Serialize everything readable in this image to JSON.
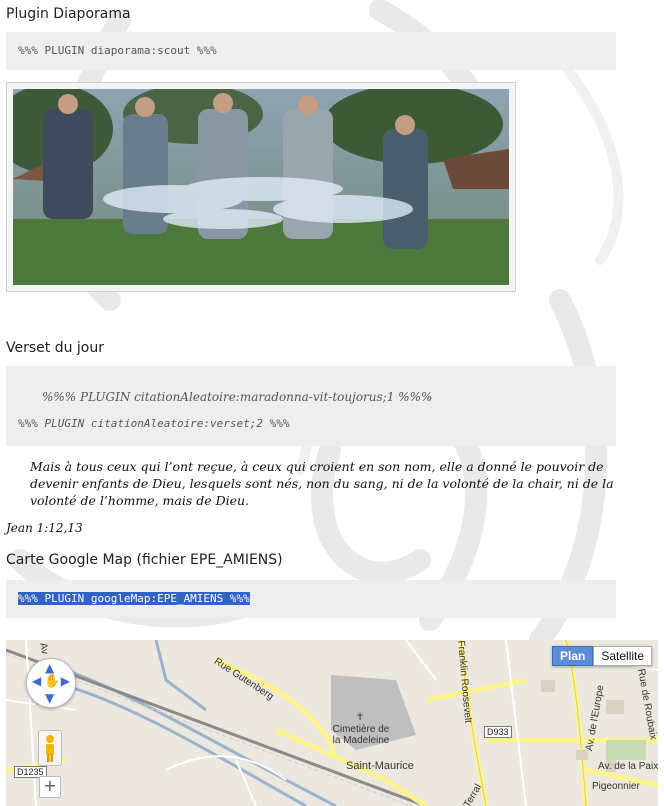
{
  "diaporama": {
    "heading": "Plugin Diaporama",
    "code": "%%% PLUGIN diaporama:scout %%%"
  },
  "verset": {
    "heading": "Verset du jour",
    "code_line_1": "%%% PLUGIN citationAleatoire:maradonna-vit-toujorus;1 %%%",
    "code_line_2": "%%% PLUGIN citationAleatoire:verset;2 %%%",
    "quote": "Mais à tous ceux qui l’ont reçue, à ceux qui croient en son nom, elle a donné le pouvoir de devenir enfants de Dieu, lesquels sont nés, non du sang, ni de la volonté de la chair, ni de la volonté de l’homme, mais de Dieu.",
    "reference": "Jean 1:12,13"
  },
  "carte": {
    "heading": "Carte Google Map (fichier EPE_AMIENS)",
    "code": "%%% PLUGIN googleMap:EPE_AMIENS %%%"
  },
  "map": {
    "plan_label": "Plan",
    "satellite_label": "Satellite",
    "labels": {
      "rue_gutenberg": "Rue Gutenberg",
      "cimetiere": "Cimetière de la Madeleine",
      "saint_maurice": "Saint-Maurice",
      "franklin": "Franklin Roosevelt",
      "europe": "Av. de l'Europe",
      "paix": "Av. de la Paix",
      "pigeonnier": "Pigeonnier",
      "roubaix": "Rue de Roubaix",
      "terral": "Terral",
      "av_short": "Av"
    },
    "road_tags": {
      "d933": "D933",
      "d1235": "D1235"
    },
    "colors": {
      "land": "#ece8df",
      "road_yellow": "#fdf48e",
      "water": "#99b3cc",
      "cemetery": "#bfbfbf"
    }
  }
}
